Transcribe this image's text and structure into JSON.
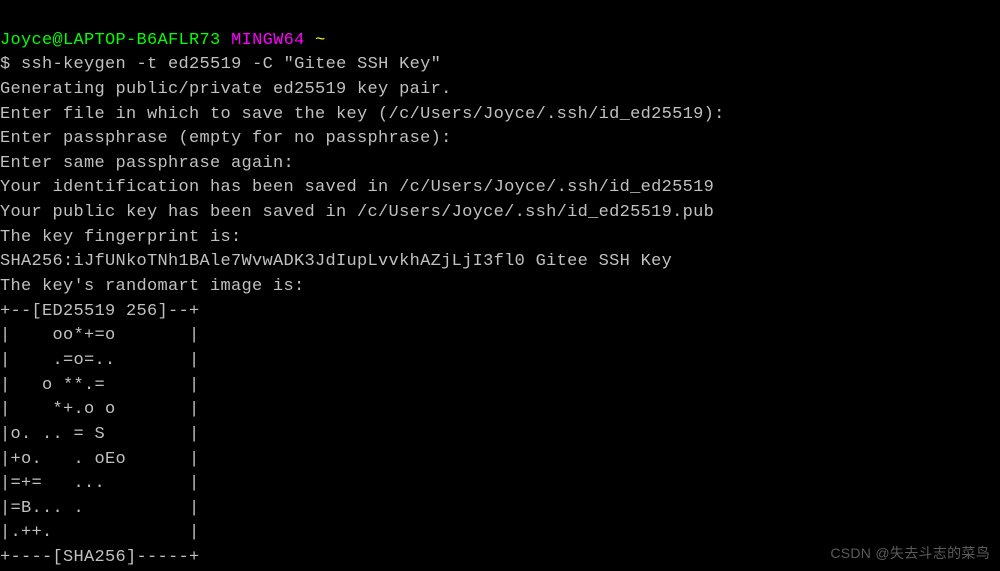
{
  "prompt": {
    "user": "Joyce@LAPTOP-B6AFLR73",
    "env": "MINGW64",
    "path": "~",
    "symbol": "$"
  },
  "command": "ssh-keygen -t ed25519 -C \"Gitee SSH Key\"",
  "output": {
    "line1": "Generating public/private ed25519 key pair.",
    "line2": "Enter file in which to save the key (/c/Users/Joyce/.ssh/id_ed25519):",
    "line3": "Enter passphrase (empty for no passphrase):",
    "line4": "Enter same passphrase again:",
    "line5": "Your identification has been saved in /c/Users/Joyce/.ssh/id_ed25519",
    "line6": "Your public key has been saved in /c/Users/Joyce/.ssh/id_ed25519.pub",
    "line7": "The key fingerprint is:",
    "line8": "SHA256:iJfUNkoTNh1BAle7WvwADK3JdIupLvvkhAZjLjI3fl0 Gitee SSH Key",
    "line9": "The key's randomart image is:",
    "art1": "+--[ED25519 256]--+",
    "art2": "|    oo*+=o       |",
    "art3": "|    .=o=..       |",
    "art4": "|   o **.=        |",
    "art5": "|    *+.o o       |",
    "art6": "|o. .. = S        |",
    "art7": "|+o.   . oEo      |",
    "art8": "|=+=   ...        |",
    "art9": "|=B... .          |",
    "art10": "|.++.             |",
    "art11": "+----[SHA256]-----+"
  },
  "watermark": "CSDN @失去斗志的菜鸟"
}
